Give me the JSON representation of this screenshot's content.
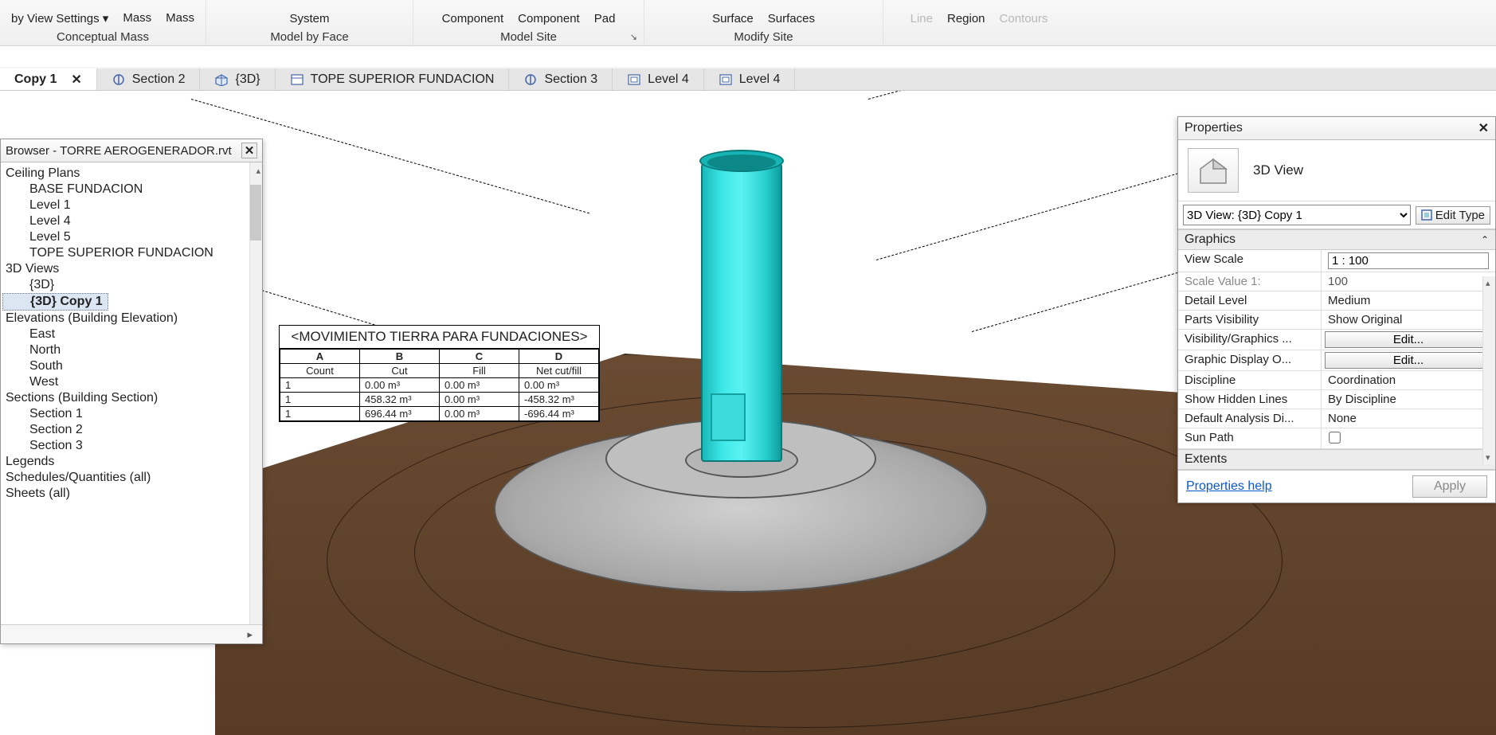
{
  "ribbon": {
    "groups": [
      {
        "labels": [
          "by View Settings ▾",
          "Mass",
          "Mass"
        ],
        "name": "Conceptual Mass"
      },
      {
        "labels": [
          "System"
        ],
        "name": "Model by Face"
      },
      {
        "labels": [
          "Component",
          "Component",
          "Pad"
        ],
        "name": "Model Site",
        "expander": "↘"
      },
      {
        "labels": [
          "Surface",
          "Surfaces"
        ],
        "name": "Modify Site"
      },
      {
        "labels": [
          "Line",
          "Region",
          "Contours"
        ],
        "name": "",
        "disabled": true
      }
    ]
  },
  "tabs": [
    {
      "label": "Copy 1",
      "active": true,
      "closable": true
    },
    {
      "label": "Section 2",
      "icon": "section-icon"
    },
    {
      "label": "{3D}",
      "icon": "cube-icon"
    },
    {
      "label": "TOPE SUPERIOR FUNDACION",
      "icon": "sheet-icon"
    },
    {
      "label": "Section 3",
      "icon": "section-icon"
    },
    {
      "label": "Level 4",
      "icon": "plan-icon"
    },
    {
      "label": "Level 4",
      "icon": "plan-icon"
    }
  ],
  "browser": {
    "title": "Browser - TORRE AEROGENERADOR.rvt",
    "tree": [
      {
        "l": 1,
        "t": "Ceiling Plans",
        "collapsible": true
      },
      {
        "l": 2,
        "t": "BASE FUNDACION"
      },
      {
        "l": 2,
        "t": "Level 1"
      },
      {
        "l": 2,
        "t": "Level 4"
      },
      {
        "l": 2,
        "t": "Level 5"
      },
      {
        "l": 2,
        "t": "TOPE SUPERIOR FUNDACION"
      },
      {
        "l": 1,
        "t": "3D Views",
        "collapsible": true
      },
      {
        "l": 2,
        "t": "{3D}"
      },
      {
        "l": 2,
        "t": "{3D} Copy 1",
        "bold": true,
        "selected": true
      },
      {
        "l": 1,
        "t": "Elevations (Building Elevation)",
        "collapsible": true
      },
      {
        "l": 2,
        "t": "East"
      },
      {
        "l": 2,
        "t": "North"
      },
      {
        "l": 2,
        "t": "South"
      },
      {
        "l": 2,
        "t": "West"
      },
      {
        "l": 1,
        "t": "Sections (Building Section)",
        "collapsible": true
      },
      {
        "l": 2,
        "t": "Section 1"
      },
      {
        "l": 2,
        "t": "Section 2"
      },
      {
        "l": 2,
        "t": "Section 3"
      },
      {
        "l": 1,
        "t": "Legends"
      },
      {
        "l": 1,
        "t": "Schedules/Quantities (all)"
      },
      {
        "l": 1,
        "t": "Sheets (all)"
      }
    ]
  },
  "schedule": {
    "title": "<MOVIMIENTO TIERRA PARA FUNDACIONES>",
    "letters": [
      "A",
      "B",
      "C",
      "D"
    ],
    "headers": [
      "Count",
      "Cut",
      "Fill",
      "Net cut/fill"
    ],
    "rows": [
      [
        "1",
        "0.00 m³",
        "0.00 m³",
        "0.00 m³"
      ],
      [
        "1",
        "458.32 m³",
        "0.00 m³",
        "-458.32 m³"
      ],
      [
        "1",
        "696.44 m³",
        "0.00 m³",
        "-696.44 m³"
      ]
    ]
  },
  "properties": {
    "title": "Properties",
    "typeName": "3D View",
    "instanceSelector": "3D View: {3D} Copy 1",
    "editType": "Edit Type",
    "groups": [
      {
        "name": "Graphics",
        "rows": [
          {
            "k": "View Scale",
            "v": "1 : 100",
            "kind": "text"
          },
          {
            "k": "Scale Value    1:",
            "v": "100",
            "kind": "readonly"
          },
          {
            "k": "Detail Level",
            "v": "Medium",
            "kind": "plain"
          },
          {
            "k": "Parts Visibility",
            "v": "Show Original",
            "kind": "plain"
          },
          {
            "k": "Visibility/Graphics ...",
            "v": "Edit...",
            "kind": "button"
          },
          {
            "k": "Graphic Display O...",
            "v": "Edit...",
            "kind": "button"
          },
          {
            "k": "Discipline",
            "v": "Coordination",
            "kind": "plain"
          },
          {
            "k": "Show Hidden Lines",
            "v": "By Discipline",
            "kind": "plain"
          },
          {
            "k": "Default Analysis Di...",
            "v": "None",
            "kind": "plain"
          },
          {
            "k": "Sun Path",
            "v": "",
            "kind": "check"
          }
        ]
      },
      {
        "name": "Extents",
        "rows": []
      }
    ],
    "helpLink": "Properties help",
    "apply": "Apply"
  }
}
